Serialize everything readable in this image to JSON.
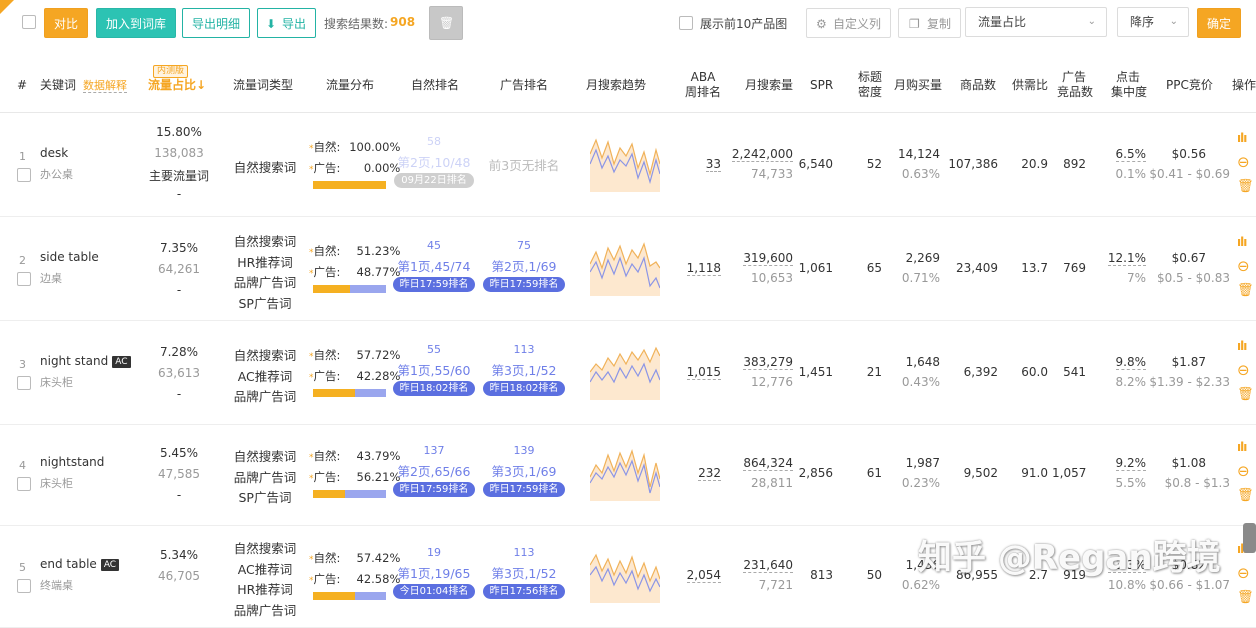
{
  "toolbar": {
    "compare": "对比",
    "add_to_lib": "加入到词库",
    "export_detail": "导出明细",
    "export": "导出",
    "result_label": "搜索结果数:",
    "result_count": "908",
    "show_top10": "展示前10产品图",
    "custom_cols": "自定义列",
    "copy": "复制",
    "sort_field": "流量占比",
    "sort_order": "降序",
    "confirm": "确定"
  },
  "headers": {
    "idx": "#",
    "keyword": "关键词",
    "data_explain": "数据解释",
    "beta": "内测版",
    "traffic_share": "流量占比↓",
    "traffic_type": "流量词类型",
    "traffic_dist": "流量分布",
    "natural_rank": "自然排名",
    "ad_rank": "广告排名",
    "monthly_trend": "月搜索趋势",
    "aba_rank": "ABA\n周排名",
    "monthly_search": "月搜索量",
    "spr": "SPR",
    "title_density": "标题\n密度",
    "monthly_buy": "月购买量",
    "product_count": "商品数",
    "supply_ratio": "供需比",
    "ad_product_count": "广告\n竞品数",
    "click_conc": "点击\n集中度",
    "ppc": "PPC竞价",
    "ops": "操作"
  },
  "labels": {
    "natural": "自然:",
    "ad": "广告:"
  },
  "rows": [
    {
      "idx": "1",
      "kw": "desk",
      "kw_cn": "办公桌",
      "ac": false,
      "share": "15.80%",
      "share_num": "138,083",
      "share_note": "主要流量词",
      "share_dash": "-",
      "types": [
        "自然搜索词"
      ],
      "nat_pct": "100.00%",
      "ad_pct": "0.00%",
      "ad_frac": 1.0,
      "nrank_top": "58",
      "nrank": "第2页,10/48",
      "nrank_pill": "09月22日排名",
      "nfaded": true,
      "arank_top": "",
      "arank": "前3页无排名",
      "arank_pill": "",
      "aba": "33",
      "msearch": "2,242,000",
      "msearch_sub": "74,733",
      "spr": "6,540",
      "density": "52",
      "mbuy": "14,124",
      "mbuy_pct": "0.63%",
      "products": "107,386",
      "supply": "20.9",
      "adprod": "892",
      "click": "6.5%",
      "click_sub": "0.1%",
      "ppc": "$0.56",
      "ppc_range": "$0.41 - $0.69"
    },
    {
      "idx": "2",
      "kw": "side table",
      "kw_cn": "边桌",
      "ac": false,
      "share": "7.35%",
      "share_num": "64,261",
      "share_note": "",
      "share_dash": "-",
      "types": [
        "自然搜索词",
        "HR推荐词",
        "品牌广告词",
        "SP广告词"
      ],
      "nat_pct": "51.23%",
      "ad_pct": "48.77%",
      "ad_frac": 0.4877,
      "nrank_top": "45",
      "nrank": "第1页,45/74",
      "nrank_pill": "昨日17:59排名",
      "nfaded": false,
      "arank_top": "75",
      "arank": "第2页,1/69",
      "arank_pill": "昨日17:59排名",
      "aba": "1,118",
      "msearch": "319,600",
      "msearch_sub": "10,653",
      "spr": "1,061",
      "density": "65",
      "mbuy": "2,269",
      "mbuy_pct": "0.71%",
      "products": "23,409",
      "supply": "13.7",
      "adprod": "769",
      "click": "12.1%",
      "click_sub": "7%",
      "ppc": "$0.67",
      "ppc_range": "$0.5 - $0.83"
    },
    {
      "idx": "3",
      "kw": "night stand",
      "kw_cn": "床头柜",
      "ac": true,
      "share": "7.28%",
      "share_num": "63,613",
      "share_note": "",
      "share_dash": "-",
      "types": [
        "自然搜索词",
        "AC推荐词",
        "品牌广告词"
      ],
      "nat_pct": "57.72%",
      "ad_pct": "42.28%",
      "ad_frac": 0.4228,
      "nrank_top": "55",
      "nrank": "第1页,55/60",
      "nrank_pill": "昨日18:02排名",
      "nfaded": false,
      "arank_top": "113",
      "arank": "第3页,1/52",
      "arank_pill": "昨日18:02排名",
      "aba": "1,015",
      "msearch": "383,279",
      "msearch_sub": "12,776",
      "spr": "1,451",
      "density": "21",
      "mbuy": "1,648",
      "mbuy_pct": "0.43%",
      "products": "6,392",
      "supply": "60.0",
      "adprod": "541",
      "click": "9.8%",
      "click_sub": "8.2%",
      "ppc": "$1.87",
      "ppc_range": "$1.39 - $2.33"
    },
    {
      "idx": "4",
      "kw": "nightstand",
      "kw_cn": "床头柜",
      "ac": false,
      "share": "5.45%",
      "share_num": "47,585",
      "share_note": "",
      "share_dash": "-",
      "types": [
        "自然搜索词",
        "品牌广告词",
        "SP广告词"
      ],
      "nat_pct": "43.79%",
      "ad_pct": "56.21%",
      "ad_frac": 0.5621,
      "nrank_top": "137",
      "nrank": "第2页,65/66",
      "nrank_pill": "昨日17:59排名",
      "nfaded": false,
      "arank_top": "139",
      "arank": "第3页,1/69",
      "arank_pill": "昨日17:59排名",
      "aba": "232",
      "msearch": "864,324",
      "msearch_sub": "28,811",
      "spr": "2,856",
      "density": "61",
      "mbuy": "1,987",
      "mbuy_pct": "0.23%",
      "products": "9,502",
      "supply": "91.0",
      "adprod": "1,057",
      "click": "9.2%",
      "click_sub": "5.5%",
      "ppc": "$1.08",
      "ppc_range": "$0.8 - $1.3"
    },
    {
      "idx": "5",
      "kw": "end table",
      "kw_cn": "终端桌",
      "ac": true,
      "share": "5.34%",
      "share_num": "46,705",
      "share_note": "",
      "share_dash": "",
      "types": [
        "自然搜索词",
        "AC推荐词",
        "HR推荐词",
        "品牌广告词"
      ],
      "nat_pct": "57.42%",
      "ad_pct": "42.58%",
      "ad_frac": 0.4258,
      "nrank_top": "19",
      "nrank": "第1页,19/65",
      "nrank_pill": "今日01:04排名",
      "nfaded": false,
      "arank_top": "113",
      "arank": "第3页,1/52",
      "arank_pill": "昨日17:56排名",
      "aba": "2,054",
      "msearch": "231,640",
      "msearch_sub": "7,721",
      "spr": "813",
      "density": "50",
      "mbuy": "1,436",
      "mbuy_pct": "0.62%",
      "products": "86,955",
      "supply": "2.7",
      "adprod": "919",
      "click": "13.3%",
      "click_sub": "10.8%",
      "ppc": "$0.82",
      "ppc_range": "$0.66 - $1.07"
    }
  ],
  "ac_label": "AC",
  "watermark": "知乎 @Regan跨境",
  "colors": {
    "accent": "#f5a623",
    "teal": "#2cc3b3",
    "rank_blue": "#6f7fe8",
    "ad_bar": "#f5b021",
    "nat_bar": "#9aa6ee"
  }
}
